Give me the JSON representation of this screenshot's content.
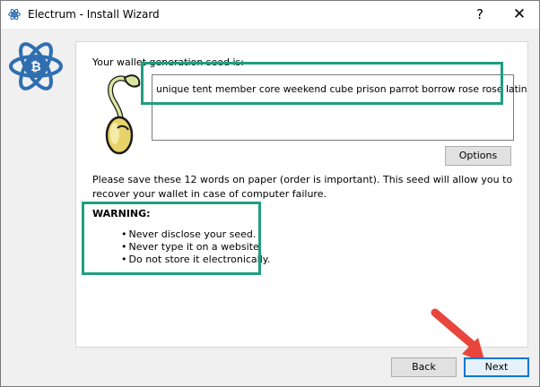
{
  "window": {
    "title": "Electrum  -  Install Wizard",
    "help_label": "?",
    "close_label": "✕"
  },
  "seed": {
    "label": "Your wallet generation seed is:",
    "words": "unique tent member core weekend cube prison parrot borrow rose rose latin"
  },
  "buttons": {
    "options": "Options",
    "back": "Back",
    "next": "Next"
  },
  "info": {
    "text": "Please save these 12 words on paper (order is important). This seed will allow you to recover your wallet in case of computer failure."
  },
  "warning": {
    "title": "WARNING:",
    "items": [
      "Never disclose your seed.",
      "Never type it on a website.",
      "Do not store it electronically."
    ]
  },
  "colors": {
    "highlight": "#1f9e80",
    "arrow": "#e8453c",
    "logo": "#2f6fb0",
    "focus": "#0078d7"
  },
  "icons": [
    "electrum-logo-icon",
    "seed-sprout-icon",
    "help-icon",
    "close-icon",
    "pointer-arrow-icon"
  ]
}
